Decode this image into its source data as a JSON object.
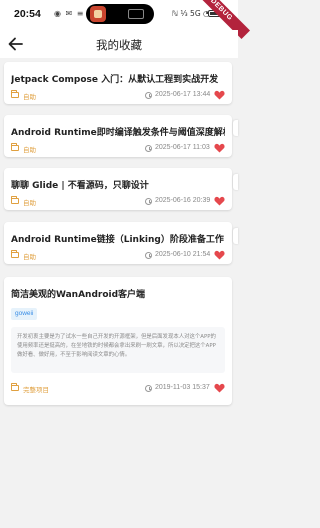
{
  "status_bar": {
    "time": "20:54",
    "left_glyphs": "◉ ✉ ≡",
    "right_glyphs": "ℕ ⅓ 5G ◔",
    "debug_label": "DEBUG"
  },
  "app_bar": {
    "back_icon": "arrow-left-icon",
    "title": "我的收藏"
  },
  "colors": {
    "accent_orange": "#e0a040",
    "heart_red": "#e5484d",
    "chip_blue": "#3a8ee6"
  },
  "favorites": [
    {
      "title": "Jetpack Compose 入门：从默认工程到实战开发",
      "category": "自助",
      "date": "2025-06-17 13:44"
    },
    {
      "title": "Android Runtime即时编译触发条件与阈值深度解析",
      "category": "自助",
      "date": "2025-06-17 11:03"
    },
    {
      "title": "聊聊 Glide | 不看源码，只聊设计",
      "category": "自助",
      "date": "2025-06-16 20:39"
    },
    {
      "title": "Android Runtime链接（Linking）阶段准备工作",
      "category": "自助",
      "date": "2025-06-10 21:54"
    },
    {
      "title": "简洁美观的WanAndroid客户端",
      "author": "goweii",
      "description": "开发初衷主要是为了试水一些自己开发的开源框架，但是后面发现本人对这个APP的使用频率还是挺高的，在坐地铁的时候都会拿出来刷一刷文章，所以决定把这个APP做好看、做好用，不至于影响阅读文章的心情。",
      "category": "完整项目",
      "date": "2019-11-03 15:37"
    }
  ]
}
